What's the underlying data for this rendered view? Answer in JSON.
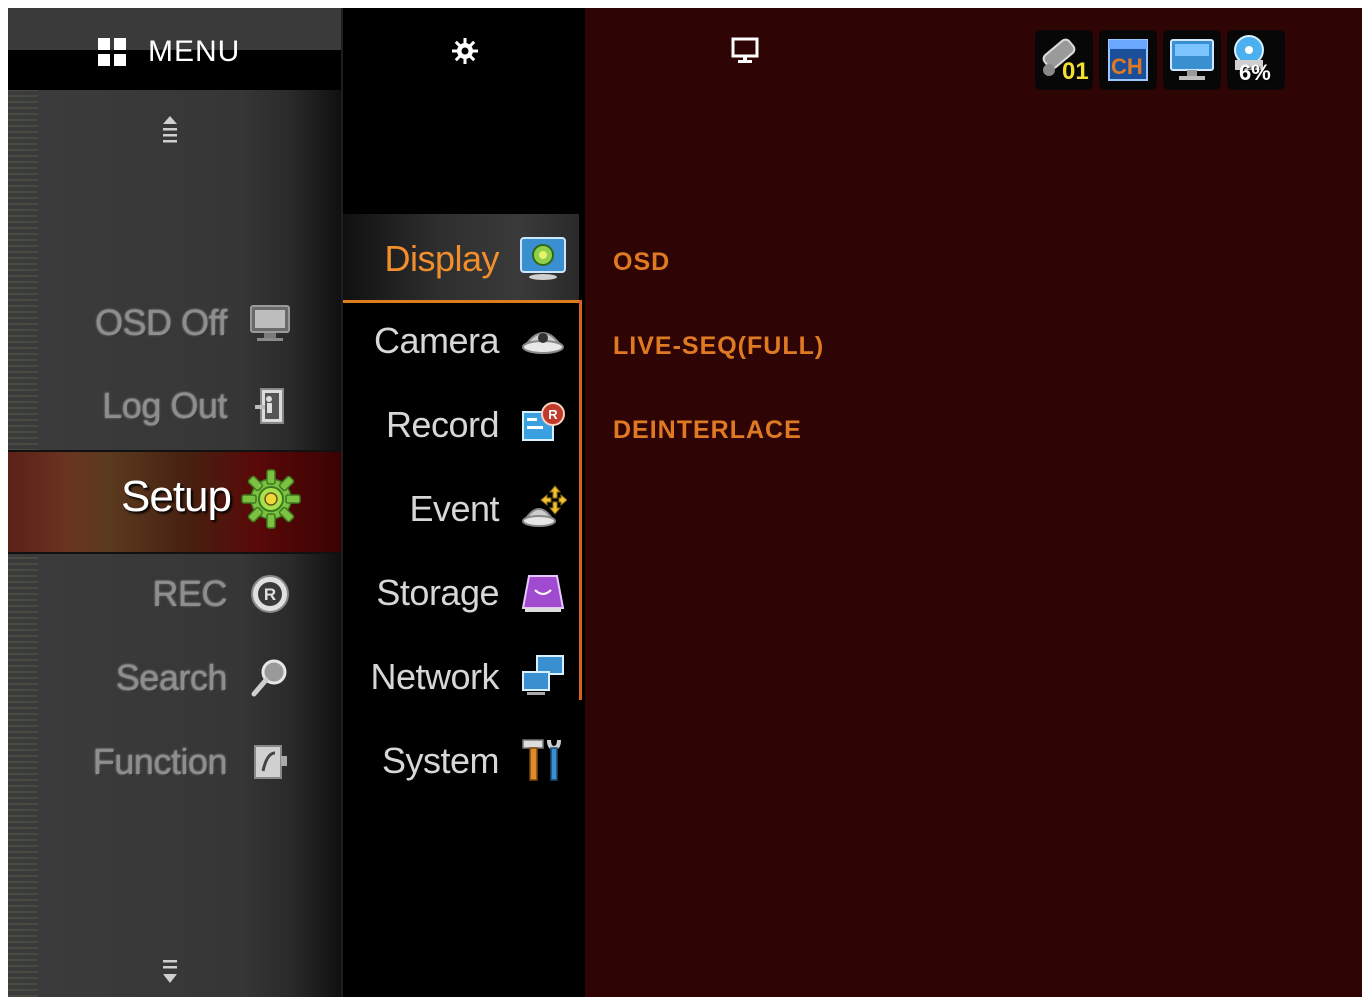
{
  "menu": {
    "title": "MENU",
    "items": [
      {
        "label": "OSD Off",
        "icon": "monitor-icon"
      },
      {
        "label": "Log Out",
        "icon": "logout-icon"
      },
      {
        "label": "Setup",
        "icon": "gear-icon",
        "selected": true
      },
      {
        "label": "REC",
        "icon": "record-icon"
      },
      {
        "label": "Search",
        "icon": "magnifier-icon"
      },
      {
        "label": "Function",
        "icon": "function-icon"
      }
    ]
  },
  "submenu": {
    "header_icon": "gear-icon",
    "items": [
      {
        "label": "Display",
        "icon": "display-settings-icon",
        "active": true
      },
      {
        "label": "Camera",
        "icon": "dome-camera-icon"
      },
      {
        "label": "Record",
        "icon": "record-settings-icon"
      },
      {
        "label": "Event",
        "icon": "event-icon"
      },
      {
        "label": "Storage",
        "icon": "storage-icon"
      },
      {
        "label": "Network",
        "icon": "network-icon"
      },
      {
        "label": "System",
        "icon": "system-tools-icon"
      }
    ]
  },
  "content": {
    "header_icon": "monitor-icon",
    "items": [
      "OSD",
      "LIVE-SEQ(FULL)",
      "DEINTERLACE"
    ]
  },
  "status": {
    "channel_number": "01",
    "ch_label": "CH",
    "disk_usage": "6%"
  },
  "colors": {
    "accent": "#e07a22",
    "content_bg": "#2e0405",
    "active_label": "#f28e2c"
  }
}
